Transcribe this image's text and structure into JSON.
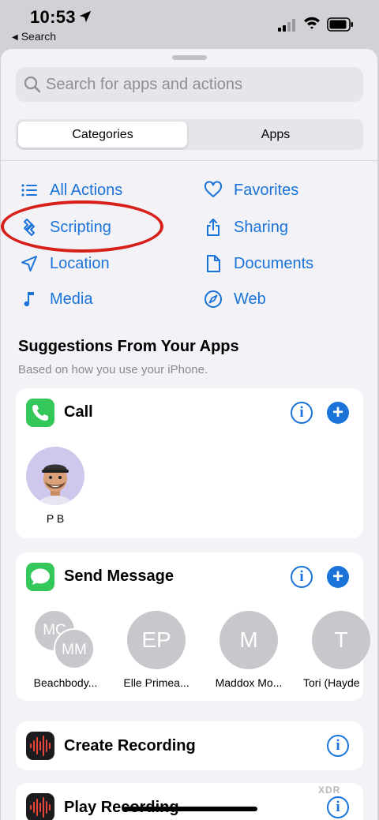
{
  "status_bar": {
    "time": "10:53",
    "back_label": "Search"
  },
  "search": {
    "placeholder": "Search for apps and actions"
  },
  "segments": {
    "categories": "Categories",
    "apps": "Apps"
  },
  "categories": {
    "all_actions": "All Actions",
    "favorites": "Favorites",
    "scripting": "Scripting",
    "sharing": "Sharing",
    "location": "Location",
    "documents": "Documents",
    "media": "Media",
    "web": "Web"
  },
  "suggestions": {
    "title": "Suggestions From Your Apps",
    "subtitle": "Based on how you use your iPhone."
  },
  "call_card": {
    "title": "Call",
    "contact_name": "P B"
  },
  "message_card": {
    "title": "Send Message",
    "contacts": [
      {
        "initials_back": "MC",
        "initials_front": "MM",
        "name": "Beachbody..."
      },
      {
        "initials": "EP",
        "name": "Elle Primea..."
      },
      {
        "initials": "M",
        "name": "Maddox Mo..."
      },
      {
        "initials": "T",
        "name": "Tori (Hayde"
      }
    ]
  },
  "create_recording": {
    "title": "Create Recording"
  },
  "play_recording": {
    "title": "Play Recording"
  },
  "watermark": "XDR",
  "colors": {
    "accent": "#1a73d9",
    "highlight": "#d8201b",
    "phone_green": "#34c759"
  }
}
